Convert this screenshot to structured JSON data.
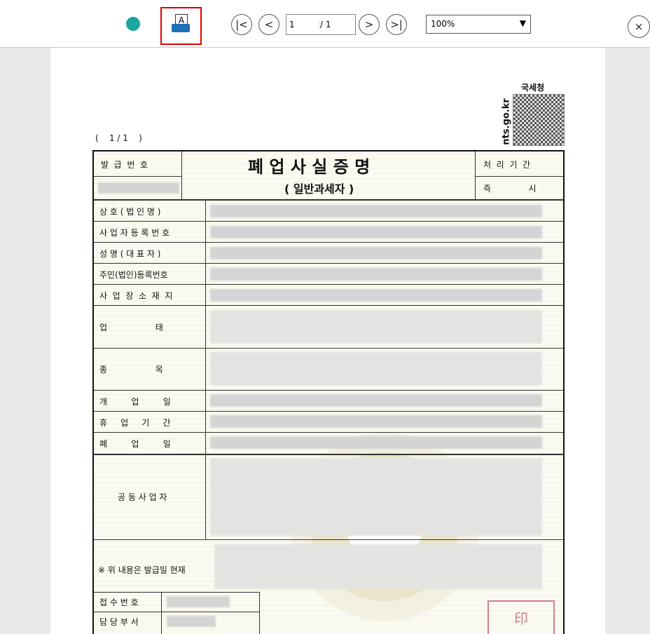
{
  "toolbar": {
    "page_current": "1",
    "page_total": "/ 1",
    "zoom_value": "100%",
    "first_page_glyph": "|<",
    "prev_glyph": "<",
    "next_glyph": ">",
    "last_page_glyph": ">|",
    "close_glyph": "×",
    "print_glyph": "A",
    "accent_color": "#e00000"
  },
  "header": {
    "agency": "국세청",
    "site": "nts.go.kr",
    "page_indicator": "(    1 / 1    )"
  },
  "document": {
    "title": "폐 업 사 실 증 명",
    "subtitle": "( 일반과세자 )",
    "issue_no_label": "발  급  번  호",
    "processing_label": "처  리  기  간",
    "processing_value": "즉              시",
    "rows": [
      "상 호 ( 법 인 명 )",
      "사 업 자 등 록 번 호",
      "성 명 ( 대 표 자 )",
      "주민(법인)등록번호",
      "사  업  장  소  재  지",
      "업                  태",
      "종                  목",
      "개         업         일",
      "휴     업     기     간",
      "폐         업         일"
    ],
    "joint_label": "공 동 사 업 자",
    "footer_note": "※ 위 내용은 발급일 현재",
    "receipt_label": "접 수 번 호",
    "dept_label": "담 당 부 서",
    "seal_text": "印"
  }
}
